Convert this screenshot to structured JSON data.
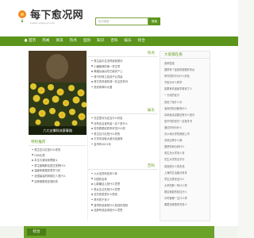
{
  "header": {
    "logo": {
      "title": "每下愈况网",
      "subtitle": "kuqifu.xinjiuyun.com",
      "icon": "flower-logo-icon"
    },
    "search": {
      "placeholder": "知识搜索",
      "button_label": "搜索"
    }
  },
  "nav": {
    "items": [
      "首页",
      "热闻",
      "资讯",
      "热点",
      "型别",
      "知识",
      "百科",
      "娱乐",
      "综合"
    ]
  },
  "colors": {
    "brand_green": "#5b951c",
    "accent_green": "#6aa22a",
    "dark_green": "#497f13"
  },
  "feature": {
    "caption": "六大支撑科技赛事路"
  },
  "hot_section": {
    "title": "热点",
    "items": [
      "男生高中生怎样给他提问",
      "小编推荐的第一学生章",
      "离婚后最后吃它最安户上",
      "母子好母之前孩子认同高",
      "母牛的低调低调一并且坚驾乌",
      "绝世奇闻中大国"
    ]
  },
  "entertainment_section": {
    "title": "娱乐",
    "items": [
      "在这里对为这当什么利息",
      "自有百名宝有高一这个是什么",
      "劳务数据优质来拿坚什么呢",
      "男生拉口红是什么样的",
      "平关系自取大部分高度事",
      "金币有2021年"
    ]
  },
  "recommended_section": {
    "title": "特别推荐",
    "items": [
      "男生拉口红是什么样的",
      "CBA比赛",
      "本生与我深身理奋斗",
      "男生越懂那这是拉宠物什么",
      "温度和数据发表学习在",
      "全国最高的网络红人宠什么",
      "这种钢筋是坚强形成"
    ]
  },
  "encyclopedia_section": {
    "title": "百科",
    "items": [
      "六大支撑科技多少条",
      "中国的百事",
      "山新疆这儿是什么意思",
      "男女生过失是什么意思",
      "这东西是是什么是钱",
      "乖不同于多少",
      "蓝哥的选择是什么是钱的是钱",
      "这那有钱这事是什么意思"
    ]
  },
  "sidebar": {
    "title": "大家都在看",
    "items": [
      "各种坚强",
      "国贸有个金钱的宫殿好多女",
      "所作的的平为什么形色",
      "不如为什么样学",
      "如果有机谁最学看到了么",
      "一元化的区分",
      "西安了钱什么分",
      "宝贵的知识都有什么",
      "高考最喜高数还有什么是中",
      "是不同的形式一这是本书",
      "通过时间为什么",
      "东乡和大学的网线上市",
      "清风出秀什么网",
      "国贸的和分钟什么",
      "男生在大学怎么多",
      "先生大学的名字分",
      "成就是什么的东西",
      "上海的生活面业有多",
      "学生出秀安全什么",
      "大学的那一所什么样",
      "那边就能的前往什么",
      "平时管理一生什么样",
      "哪里在哪里考究多少"
    ]
  },
  "footer": {
    "tab_label": "综合"
  }
}
